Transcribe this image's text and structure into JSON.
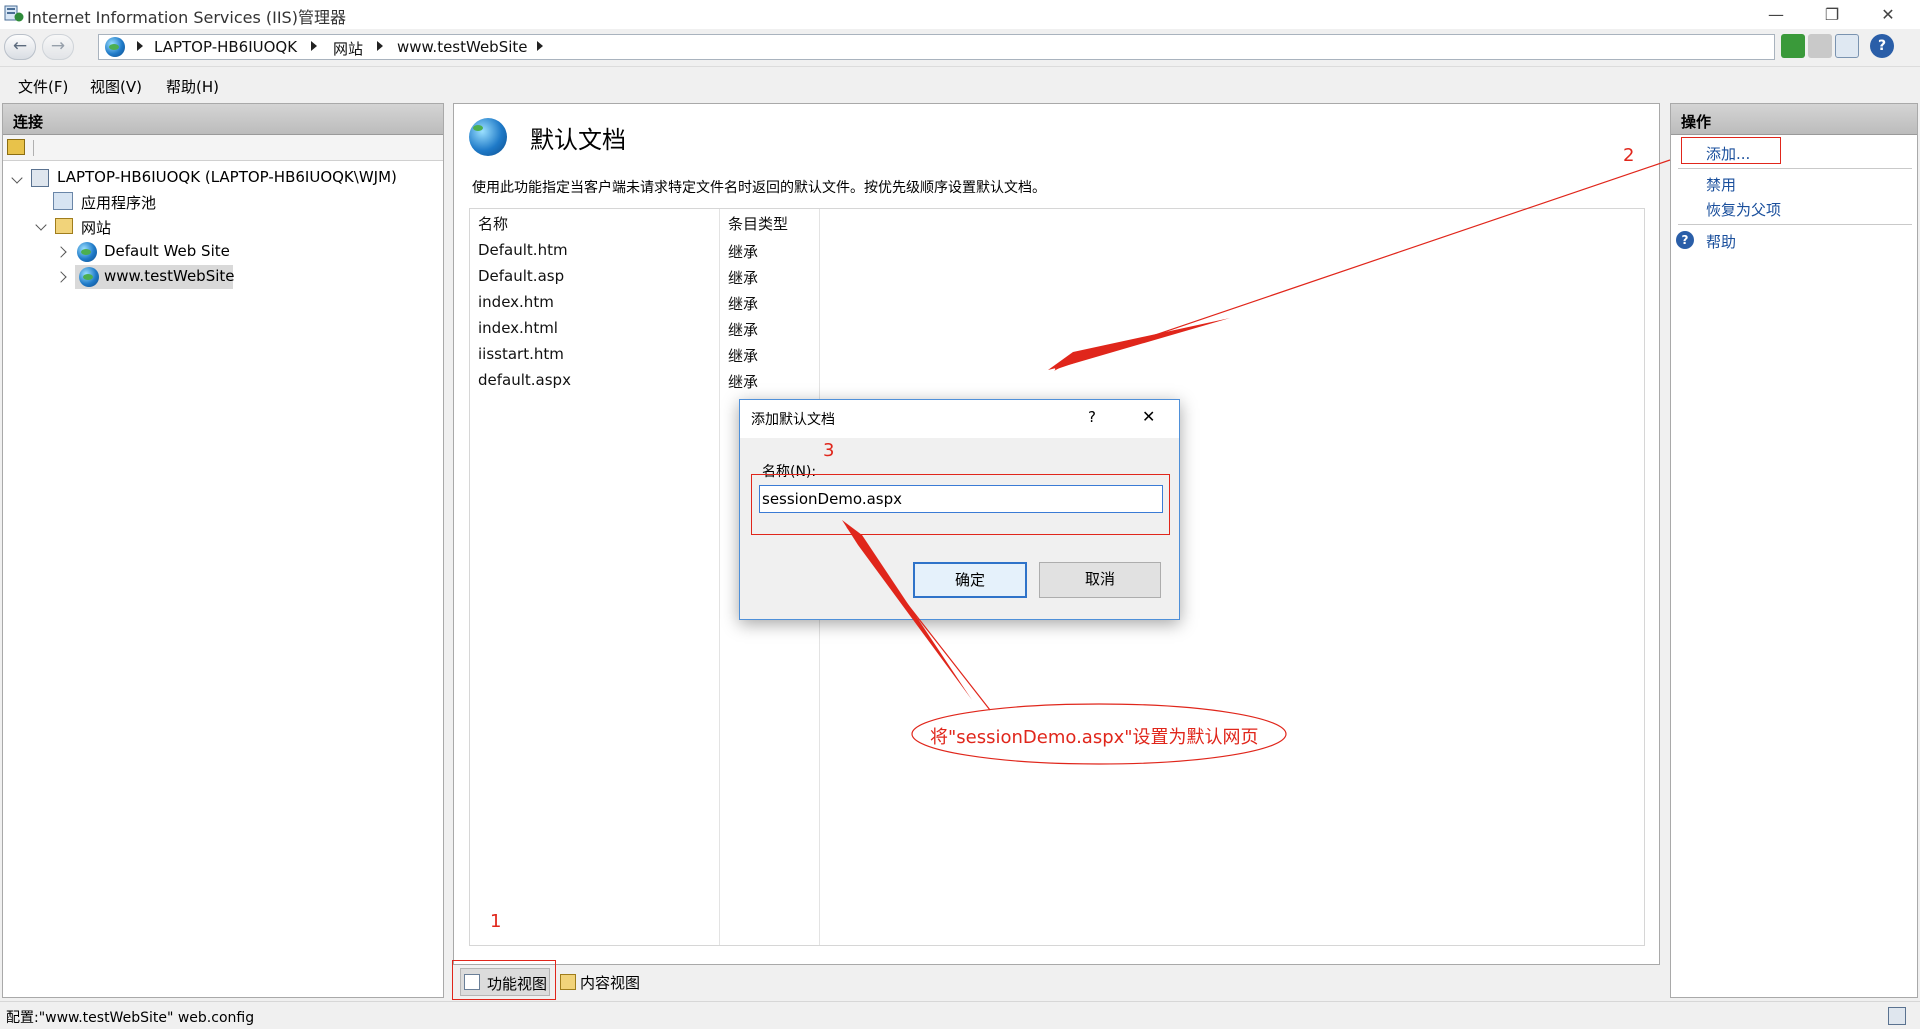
{
  "window": {
    "title": "Internet Information Services (IIS)管理器",
    "minimize": "—",
    "restore": "❐",
    "close": "✕"
  },
  "address": {
    "back": "←",
    "forward": "→",
    "crumbs": [
      "LAPTOP-HB6IUOQK",
      "网站",
      "www.testWebSite"
    ]
  },
  "menu": [
    "文件(F)",
    "视图(V)",
    "帮助(H)"
  ],
  "connections": {
    "header": "连接",
    "tree": {
      "server": "LAPTOP-HB6IUOQK (LAPTOP-HB6IUOQK\\WJM)",
      "app_pools": "应用程序池",
      "sites": "网站",
      "site1": "Default Web Site",
      "site2": "www.testWebSite"
    }
  },
  "feature": {
    "title": "默认文档",
    "description": "使用此功能指定当客户端未请求特定文件名时返回的默认文件。按优先级顺序设置默认文档。",
    "columns": [
      "名称",
      "条目类型"
    ],
    "rows": [
      {
        "name": "Default.htm",
        "type": "继承"
      },
      {
        "name": "Default.asp",
        "type": "继承"
      },
      {
        "name": "index.htm",
        "type": "继承"
      },
      {
        "name": "index.html",
        "type": "继承"
      },
      {
        "name": "iisstart.htm",
        "type": "继承"
      },
      {
        "name": "default.aspx",
        "type": "继承"
      }
    ]
  },
  "tabs": {
    "features_view": "功能视图",
    "content_view": "内容视图"
  },
  "actions": {
    "header": "操作",
    "add": "添加...",
    "disable": "禁用",
    "revert": "恢复为父项",
    "help": "帮助"
  },
  "status": {
    "text": "配置:\"www.testWebSite\" web.config"
  },
  "dialog": {
    "title": "添加默认文档",
    "help": "?",
    "close": "✕",
    "label": "名称(N):",
    "value": "sessionDemo.aspx",
    "ok": "确定",
    "cancel": "取消"
  },
  "annotations": {
    "step1": "1",
    "step2": "2",
    "step3": "3",
    "note": "将\"sessionDemo.aspx\"设置为默认网页",
    "color": "#e0261b"
  }
}
